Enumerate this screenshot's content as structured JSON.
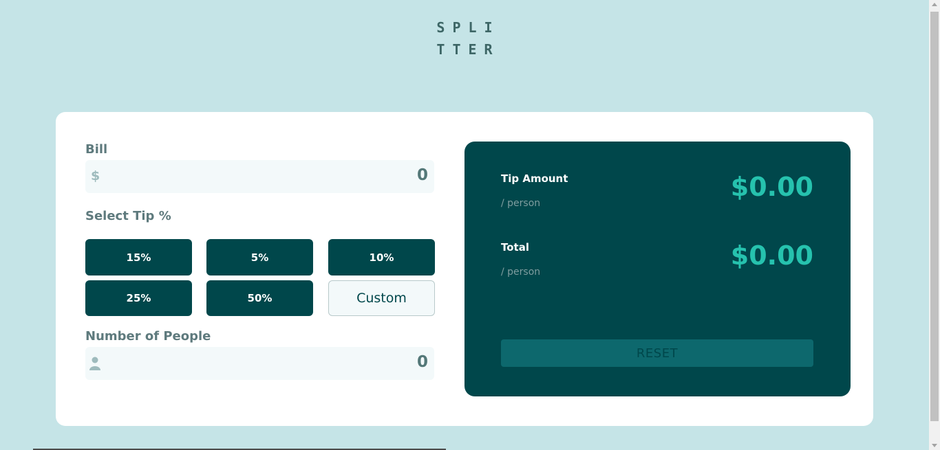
{
  "logo": {
    "line1": "SPLI",
    "line2": "TTER"
  },
  "bill": {
    "label": "Bill",
    "icon": "dollar-icon",
    "icon_glyph": "$",
    "value": "0"
  },
  "tip": {
    "label": "Select Tip %",
    "options": [
      "15%",
      "5%",
      "10%",
      "25%",
      "50%"
    ],
    "custom_label": "Custom"
  },
  "people": {
    "label": "Number of People",
    "icon": "person-icon",
    "value": "0"
  },
  "results": {
    "tip_amount": {
      "title": "Tip Amount",
      "sub": "/ person",
      "value": "$0.00"
    },
    "total": {
      "title": "Total",
      "sub": "/ person",
      "value": "$0.00"
    },
    "reset_label": "RESET"
  },
  "colors": {
    "background": "#c5e4e7",
    "card": "#ffffff",
    "dark_cyan": "#00474b",
    "accent": "#26c2ae",
    "input_bg": "#f3f9fa"
  }
}
